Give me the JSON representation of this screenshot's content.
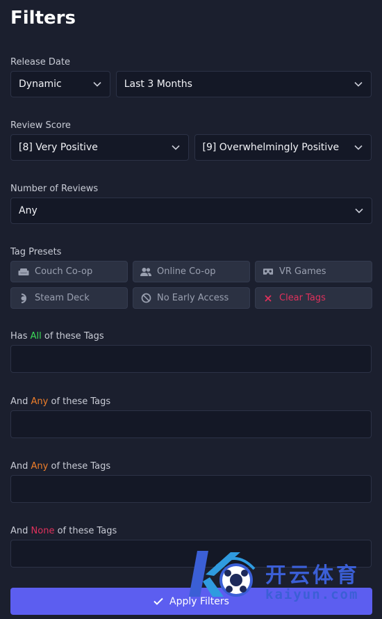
{
  "title": "Filters",
  "release_date": {
    "label": "Release Date",
    "mode": "Dynamic",
    "range": "Last 3 Months"
  },
  "review_score": {
    "label": "Review Score",
    "min": "[8] Very Positive",
    "max": "[9] Overwhelmingly Positive"
  },
  "number_of_reviews": {
    "label": "Number of Reviews",
    "value": "Any"
  },
  "tag_presets": {
    "label": "Tag Presets",
    "items": [
      {
        "label": "Couch Co-op",
        "icon": "couch-icon"
      },
      {
        "label": "Online Co-op",
        "icon": "people-icon"
      },
      {
        "label": "VR Games",
        "icon": "vr-headset-icon"
      },
      {
        "label": "Steam Deck",
        "icon": "steam-deck-icon"
      },
      {
        "label": "No Early Access",
        "icon": "no-entry-icon"
      },
      {
        "label": "Clear Tags",
        "icon": "close-icon"
      }
    ]
  },
  "tag_filters": [
    {
      "prefix": "Has ",
      "keyword": "All",
      "suffix": " of these Tags",
      "color": "#3ddc5a"
    },
    {
      "prefix": "And ",
      "keyword": "Any",
      "suffix": " of these Tags",
      "color": "#f07f2a"
    },
    {
      "prefix": "And ",
      "keyword": "Any",
      "suffix": " of these Tags",
      "color": "#f07f2a"
    },
    {
      "prefix": "And ",
      "keyword": "None",
      "suffix": " of these Tags",
      "color": "#e0315c"
    }
  ],
  "apply_button": {
    "label": "Apply Filters",
    "icon": "check-icon"
  },
  "watermark": {
    "brand_cn": "开云体育",
    "brand_en": "kaiyun.com"
  },
  "colors": {
    "background": "#1b1f2e",
    "accent": "#5c5ef0",
    "danger": "#e0315c",
    "green": "#3ddc5a",
    "orange": "#f07f2a"
  }
}
